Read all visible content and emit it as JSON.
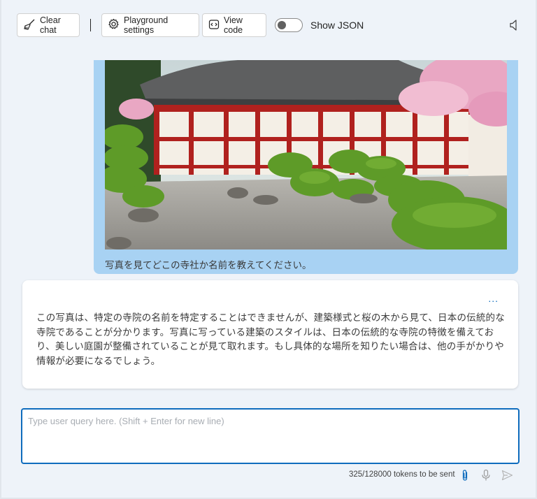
{
  "toolbar": {
    "clear_chat": "Clear chat",
    "playground_settings": "Playground settings",
    "view_code": "View code",
    "show_json": "Show JSON",
    "show_json_enabled": false
  },
  "messages": {
    "user": {
      "text": "写真を見てどこの寺社か名前を教えてください。"
    },
    "assistant": {
      "more": "...",
      "text": "この写真は、特定の寺院の名前を特定することはできませんが、建築様式と桜の木から見て、日本の伝統的な寺院であることが分かります。写真に写っている建築のスタイルは、日本の伝統的な寺院の特徴を備えており、美しい庭園が整備されていることが見て取れます。もし具体的な場所を知りたい場合は、他の手がかりや情報が必要になるでしょう。"
    }
  },
  "input": {
    "placeholder": "Type user query here. (Shift + Enter for new line)",
    "value": ""
  },
  "footer": {
    "tokens": "325/128000 tokens to be sent"
  },
  "colors": {
    "accent": "#0f6cbd",
    "user_bubble": "#a8d2f3",
    "background": "#eef3f9"
  },
  "icons": [
    "broom-icon",
    "gear-icon",
    "code-icon",
    "speaker-icon",
    "paperclip-icon",
    "microphone-icon",
    "send-icon"
  ]
}
